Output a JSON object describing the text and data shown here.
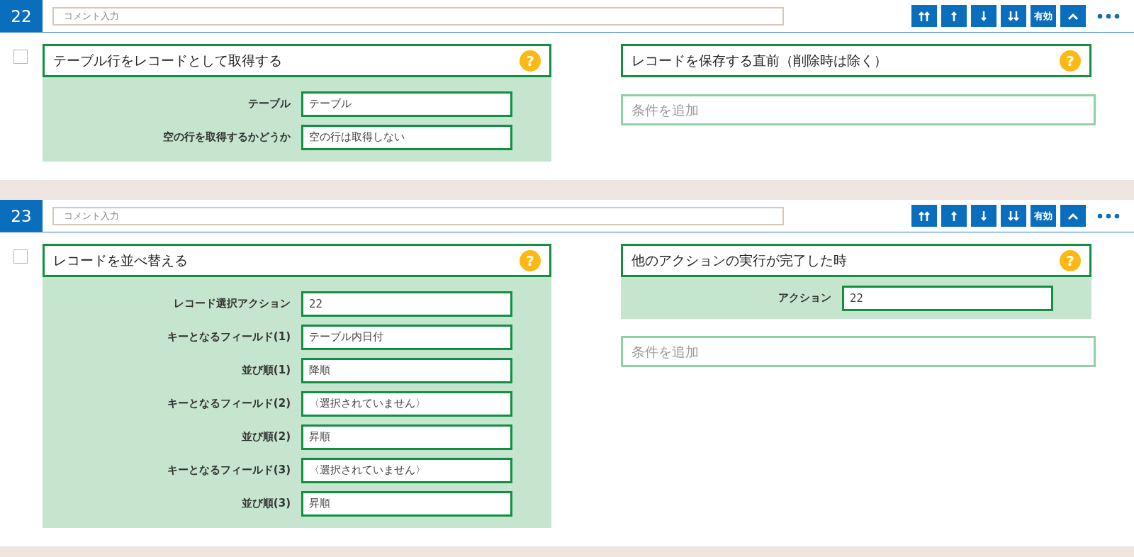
{
  "blocks": [
    {
      "number": "22",
      "comment": {
        "placeholder": "コメント入力"
      },
      "toolbar": [
        {
          "kind": "top"
        },
        {
          "kind": "up"
        },
        {
          "kind": "down"
        },
        {
          "kind": "bottom"
        },
        {
          "kind": "toggle",
          "label": "有効"
        },
        {
          "kind": "collapse"
        },
        {
          "kind": "more"
        }
      ],
      "checked": false,
      "action": {
        "title": "テーブル行をレコードとして取得する",
        "help": "?",
        "params": [
          {
            "label": "テーブル",
            "value": "テーブル"
          },
          {
            "label": "空の行を取得するかどうか",
            "value": "空の行は取得しない"
          }
        ]
      },
      "trigger": {
        "title": "レコードを保存する直前（削除時は除く）",
        "help": "?"
      },
      "condition": {
        "placeholder": "条件を追加"
      }
    },
    {
      "number": "23",
      "comment": {
        "placeholder": "コメント入力"
      },
      "toolbar": [
        {
          "kind": "top"
        },
        {
          "kind": "up"
        },
        {
          "kind": "down"
        },
        {
          "kind": "bottom"
        },
        {
          "kind": "toggle",
          "label": "有効"
        },
        {
          "kind": "collapse"
        },
        {
          "kind": "more"
        }
      ],
      "checked": false,
      "action": {
        "title": "レコードを並べ替える",
        "help": "?",
        "params": [
          {
            "label": "レコード選択アクション",
            "value": "22"
          },
          {
            "label": "キーとなるフィールド(1)",
            "value": "テーブル内日付"
          },
          {
            "label": "並び順(1)",
            "value": "降順"
          },
          {
            "label": "キーとなるフィールド(2)",
            "value": "〈選択されていません〉"
          },
          {
            "label": "並び順(2)",
            "value": "昇順"
          },
          {
            "label": "キーとなるフィールド(3)",
            "value": "〈選択されていません〉"
          },
          {
            "label": "並び順(3)",
            "value": "昇順"
          }
        ]
      },
      "trigger": {
        "title": "他のアクションの実行が完了した時",
        "help": "?",
        "params": [
          {
            "label": "アクション",
            "value": "22"
          }
        ]
      },
      "condition": {
        "placeholder": "条件を追加"
      }
    }
  ]
}
